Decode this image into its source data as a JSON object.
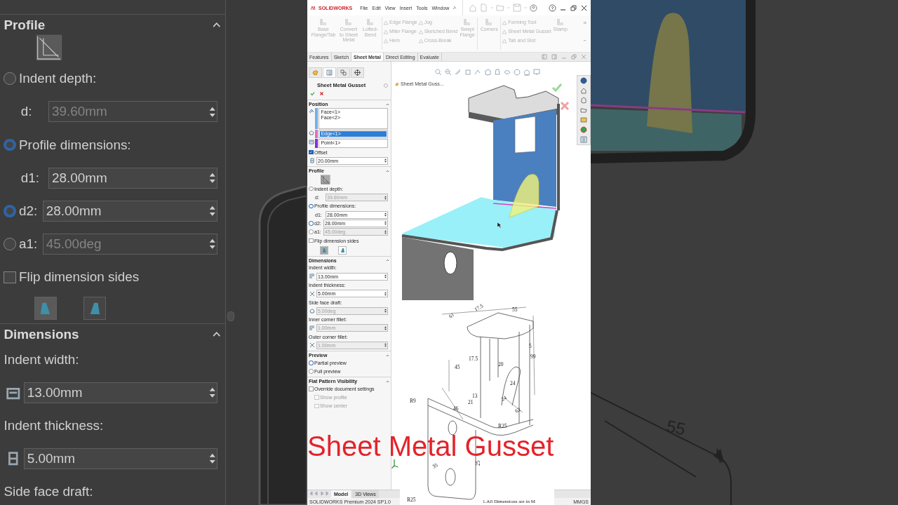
{
  "left_backdrop": {
    "sections": [
      {
        "title": "Profile",
        "expanded": true,
        "rows": [
          {
            "kind": "profile_icon"
          },
          {
            "kind": "radio",
            "label": "Indent depth:",
            "selected": false
          },
          {
            "kind": "field",
            "label": "d:",
            "value": "39.60mm",
            "disabled": true
          },
          {
            "kind": "radio",
            "label": "Profile dimensions:",
            "selected": true
          },
          {
            "kind": "field",
            "label": "d1:",
            "value": "28.00mm",
            "disabled": false
          },
          {
            "kind": "radio_field",
            "label": "d2:",
            "value": "28.00mm",
            "selected": true,
            "disabled": false
          },
          {
            "kind": "radio_field",
            "label": "a1:",
            "value": "45.00deg",
            "selected": false,
            "disabled": true
          },
          {
            "kind": "checkbox",
            "label": "Flip dimension sides",
            "checked": false,
            "disabled": false
          },
          {
            "kind": "toggle_pair",
            "buttons": [
              {
                "selected": true
              },
              {
                "selected": false
              }
            ]
          }
        ]
      },
      {
        "title": "Dimensions",
        "expanded": true,
        "rows": [
          {
            "kind": "label",
            "label": "Indent width:"
          },
          {
            "kind": "icon_field",
            "value": "13.00mm",
            "disabled": false
          },
          {
            "kind": "label",
            "label": "Indent thickness:"
          },
          {
            "kind": "icon_field",
            "value": "5.00mm",
            "disabled": false
          },
          {
            "kind": "label",
            "label": "Side face draft:"
          }
        ]
      }
    ]
  },
  "right_backdrop": {
    "dimension_label": "55"
  },
  "app": {
    "logo": "SOLIDWORKS",
    "menu": [
      "File",
      "Edit",
      "View",
      "Insert",
      "Tools",
      "Window"
    ],
    "ribbon": [
      {
        "kind": "large",
        "label": "Base Flange/Tab",
        "disabled": true
      },
      {
        "kind": "large",
        "label": "Convert to Sheet Metal",
        "disabled": true
      },
      {
        "kind": "large",
        "label": "Lofted-Bend",
        "disabled": true
      },
      {
        "kind": "separator"
      },
      {
        "kind": "stack",
        "items": [
          {
            "label": "Edge Flange",
            "disabled": true
          },
          {
            "label": "Miter Flange",
            "disabled": true
          },
          {
            "label": "Hem",
            "disabled": true
          }
        ]
      },
      {
        "kind": "stack",
        "items": [
          {
            "label": "Jog",
            "disabled": true
          },
          {
            "label": "Sketched Bend",
            "disabled": true
          },
          {
            "label": "Cross-Break",
            "disabled": true
          }
        ]
      },
      {
        "kind": "large",
        "label": "Swept Flange",
        "disabled": true
      },
      {
        "kind": "separator"
      },
      {
        "kind": "large",
        "label": "Corners",
        "disabled": true
      },
      {
        "kind": "separator"
      },
      {
        "kind": "stack",
        "items": [
          {
            "label": "Forming Tool",
            "disabled": true
          },
          {
            "label": "Sheet Metal Gusset",
            "disabled": true
          },
          {
            "label": "Tab and Slot",
            "disabled": true
          }
        ]
      },
      {
        "kind": "large",
        "label": "Stamp",
        "disabled": true
      }
    ],
    "command_tabs": [
      {
        "label": "Features",
        "selected": false
      },
      {
        "label": "Sketch",
        "selected": false
      },
      {
        "label": "Sheet Metal",
        "selected": true
      },
      {
        "label": "Direct Editing",
        "selected": false
      },
      {
        "label": "Evaluate",
        "selected": false
      }
    ],
    "property_manager": {
      "title": "Sheet Metal Gusset",
      "sections": [
        {
          "title": "Position",
          "expanded": true,
          "rows": [
            {
              "kind": "selection_box",
              "color": "#6fb0ea",
              "items": [
                {
                  "label": "Face<1>",
                  "selected": false
                },
                {
                  "label": "Face<2>",
                  "selected": false
                }
              ]
            },
            {
              "kind": "selection_box",
              "color": "#e070c0",
              "items": [
                {
                  "label": "Edge<1>",
                  "selected": true
                }
              ]
            },
            {
              "kind": "selection_box",
              "color": "#8a2be2",
              "items": [
                {
                  "label": "Point<1>",
                  "selected": false
                }
              ]
            },
            {
              "kind": "checkbox",
              "label": "Offset",
              "checked": true,
              "disabled": false
            },
            {
              "kind": "icon_field",
              "value": "20.00mm",
              "disabled": false
            }
          ]
        },
        {
          "title": "Profile",
          "expanded": true,
          "rows": [
            {
              "kind": "profile_icon"
            },
            {
              "kind": "radio",
              "label": "Indent depth:",
              "selected": false
            },
            {
              "kind": "field",
              "label": "d:",
              "value": "39.60mm",
              "disabled": true
            },
            {
              "kind": "radio",
              "label": "Profile dimensions:",
              "selected": true
            },
            {
              "kind": "field",
              "label": "d1:",
              "value": "28.00mm",
              "disabled": false
            },
            {
              "kind": "radio_field",
              "label": "d2:",
              "value": "28.00mm",
              "selected": true,
              "disabled": false
            },
            {
              "kind": "radio_field",
              "label": "a1:",
              "value": "45.00deg",
              "selected": false,
              "disabled": true
            },
            {
              "kind": "checkbox",
              "label": "Flip dimension sides",
              "checked": false,
              "disabled": false
            },
            {
              "kind": "toggle_pair",
              "buttons": [
                {
                  "selected": true
                },
                {
                  "selected": false
                }
              ]
            }
          ]
        },
        {
          "title": "Dimensions",
          "expanded": true,
          "rows": [
            {
              "kind": "label",
              "label": "Indent width:"
            },
            {
              "kind": "icon_field",
              "value": "13.00mm",
              "disabled": false
            },
            {
              "kind": "label",
              "label": "Indent thickness:"
            },
            {
              "kind": "icon_field",
              "value": "5.00mm",
              "disabled": false
            },
            {
              "kind": "label",
              "label": "Side face draft:"
            },
            {
              "kind": "icon_field",
              "value": "5.00deg",
              "disabled": true
            },
            {
              "kind": "label",
              "label": "Inner corner fillet:"
            },
            {
              "kind": "icon_field",
              "value": "1.00mm",
              "disabled": true
            },
            {
              "kind": "label",
              "label": "Outer corner fillet:"
            },
            {
              "kind": "icon_field",
              "value": "1.00mm",
              "disabled": true
            }
          ]
        },
        {
          "title": "Preview",
          "expanded": true,
          "rows": [
            {
              "kind": "radio",
              "label": "Partial preview",
              "selected": true
            },
            {
              "kind": "radio",
              "label": "Full preview",
              "selected": false
            }
          ]
        },
        {
          "title": "Flat Pattern Visibility",
          "expanded": true,
          "rows": [
            {
              "kind": "checkbox",
              "label": "Override document settings",
              "checked": false,
              "disabled": false
            },
            {
              "kind": "sub_checkbox",
              "label": "Show profile",
              "checked": false,
              "disabled": true
            },
            {
              "kind": "sub_checkbox",
              "label": "Show center",
              "checked": false,
              "disabled": true
            }
          ]
        }
      ]
    },
    "viewport": {
      "feature_flyout": "Sheet Metal Guss...",
      "drawing_labels": [
        "61",
        "17.5",
        "55",
        "5",
        "99",
        "45",
        "17.5",
        "20",
        "24",
        "13",
        "24",
        "21",
        "46",
        "62",
        "R9",
        "R25",
        "35",
        "25",
        "R25"
      ],
      "drawing_note": "1.All Dimensions are in M"
    },
    "bottom_tabs": [
      {
        "label": "Model",
        "selected": true
      },
      {
        "label": "3D Views",
        "selected": false
      }
    ],
    "status": "SOLIDWORKS Premium 2024 SP1.0",
    "units": "MMGS"
  },
  "caption": "Sheet Metal Gusset"
}
